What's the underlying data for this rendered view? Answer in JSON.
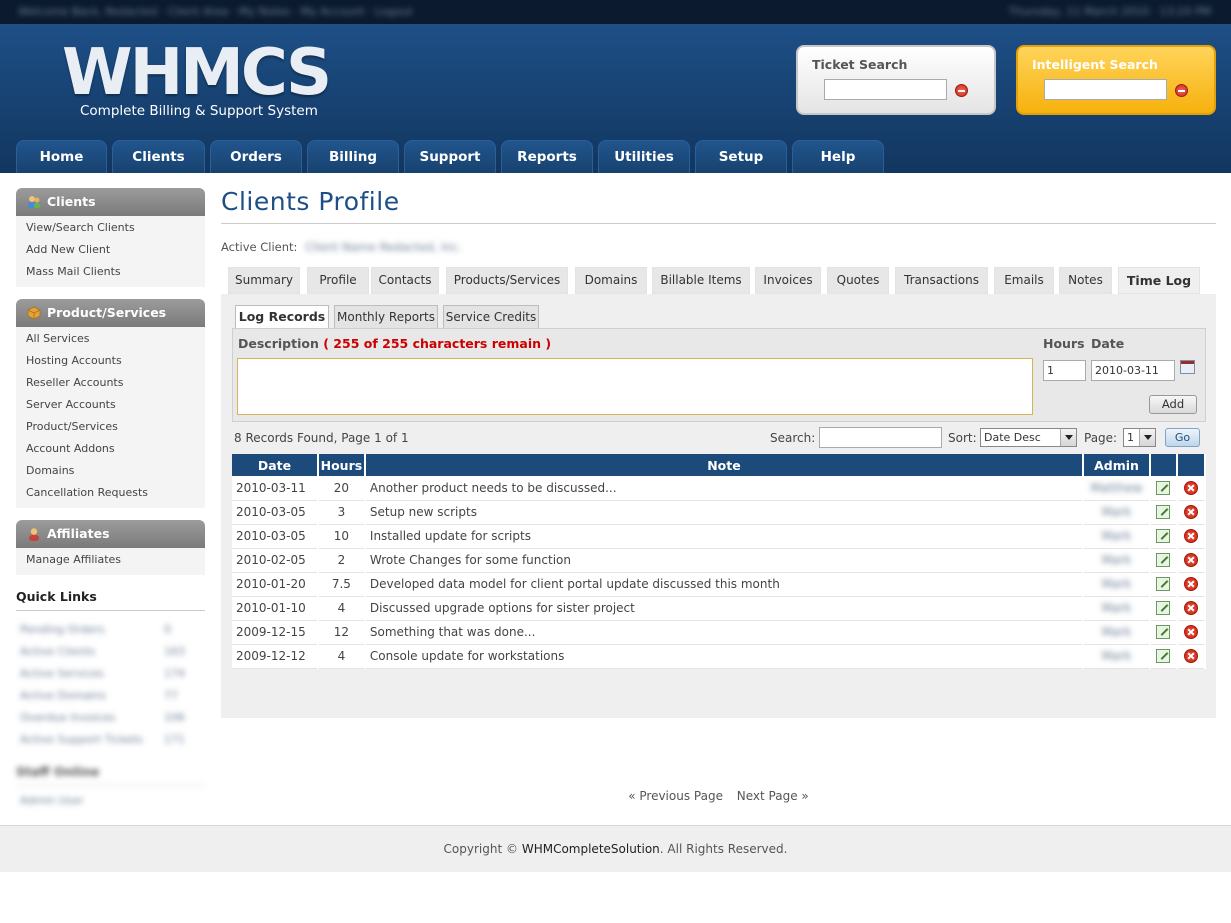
{
  "topbar": {
    "left": "Welcome Back, Redacted · Client Area · My Notes · My Account · Logout",
    "right": "Thursday, 11 March 2010 · 13:24 PM"
  },
  "header": {
    "logo": "WHMCS",
    "tagline": "Complete Billing & Support System",
    "ticket_search_label": "Ticket Search",
    "intelligent_search_label": "Intelligent Search"
  },
  "nav": [
    "Home",
    "Clients",
    "Orders",
    "Billing",
    "Support",
    "Reports",
    "Utilities",
    "Setup",
    "Help"
  ],
  "sidebar": {
    "clients": {
      "title": "Clients",
      "items": [
        "View/Search Clients",
        "Add New Client",
        "Mass Mail Clients"
      ]
    },
    "products": {
      "title": "Product/Services",
      "items": [
        "All Services",
        "Hosting Accounts",
        "Reseller Accounts",
        "Server Accounts",
        "Product/Services",
        "Account Addons",
        "Domains",
        "Cancellation Requests"
      ]
    },
    "affiliates": {
      "title": "Affiliates",
      "items": [
        "Manage Affiliates"
      ]
    },
    "quick_links_title": "Quick Links",
    "quick_links": [
      {
        "label": "Pending Orders",
        "count": "0"
      },
      {
        "label": "Active Clients",
        "count": "163"
      },
      {
        "label": "Active Services",
        "count": "174"
      },
      {
        "label": "Active Domains",
        "count": "77"
      },
      {
        "label": "Overdue Invoices",
        "count": "106"
      },
      {
        "label": "Active Support Tickets",
        "count": "171"
      }
    ],
    "staff_online": "Staff Online",
    "staff_name": "Admin User"
  },
  "main": {
    "page_title": "Clients Profile",
    "active_client_label": "Active Client:",
    "active_client_value": "Client Name Redacted, Inc.",
    "tabs": [
      "Summary",
      "Profile",
      "Contacts",
      "Products/Services",
      "Domains",
      "Billable Items",
      "Invoices",
      "Quotes",
      "Transactions",
      "Emails",
      "Notes",
      "Time Log"
    ],
    "active_tab": "Time Log",
    "subtabs": [
      "Log Records",
      "Monthly Reports",
      "Service Credits"
    ],
    "active_subtab": "Log Records",
    "description_label": "Description",
    "chars_remaining": "255 of 255 characters remain",
    "hours_label": "Hours",
    "date_label": "Date",
    "hours_value": "1",
    "date_value": "2010-03-11",
    "add_label": "Add",
    "records_found": "8 Records Found, Page 1 of 1",
    "search_label": "Search:",
    "sort_label": "Sort:",
    "sort_value": "Date Desc",
    "page_label": "Page:",
    "page_value": "1",
    "go_label": "Go",
    "columns": [
      "Date",
      "Hours",
      "Note",
      "Admin"
    ],
    "rows": [
      {
        "date": "2010-03-11",
        "hours": "20",
        "note": "Another product needs to be discussed...",
        "admin": "Matthew"
      },
      {
        "date": "2010-03-05",
        "hours": "3",
        "note": "Setup new scripts",
        "admin": "Mark"
      },
      {
        "date": "2010-03-05",
        "hours": "10",
        "note": "Installed update for scripts",
        "admin": "Mark"
      },
      {
        "date": "2010-02-05",
        "hours": "2",
        "note": "Wrote Changes for some function",
        "admin": "Mark"
      },
      {
        "date": "2010-01-20",
        "hours": "7.5",
        "note": "Developed data model for client portal update discussed this month",
        "admin": "Mark"
      },
      {
        "date": "2010-01-10",
        "hours": "4",
        "note": "Discussed upgrade options for sister project",
        "admin": "Mark"
      },
      {
        "date": "2009-12-15",
        "hours": "12",
        "note": "Something that was done...",
        "admin": "Mark"
      },
      {
        "date": "2009-12-12",
        "hours": "4",
        "note": "Console update for workstations",
        "admin": "Mark"
      }
    ],
    "prev_page": "« Previous Page",
    "next_page": "Next Page »"
  },
  "footer": {
    "copyright_prefix": "Copyright ©",
    "brand": "WHMCompleteSolution",
    "suffix": ". All Rights Reserved."
  },
  "colors": {
    "nav_blue": "#1d4f86",
    "accent_red": "#cc0000",
    "intelligent_yellow": "#f6b10d"
  }
}
